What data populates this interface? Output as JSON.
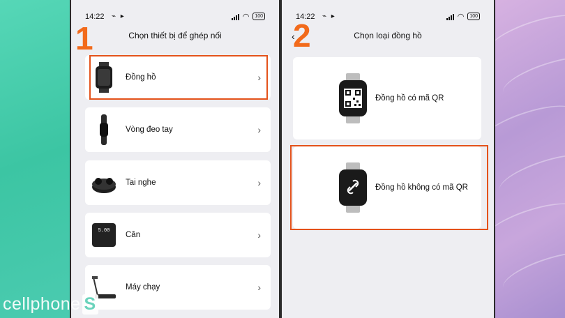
{
  "phone1": {
    "status_time": "14:22",
    "battery": "100",
    "title": "Chọn thiết bị để ghép nối",
    "items": [
      {
        "label": "Đồng hồ",
        "icon": "watch-icon",
        "highlighted": true
      },
      {
        "label": "Vòng đeo tay",
        "icon": "band-icon",
        "highlighted": false
      },
      {
        "label": "Tai nghe",
        "icon": "earbuds-icon",
        "highlighted": false
      },
      {
        "label": "Cân",
        "icon": "scale-icon",
        "highlighted": false
      },
      {
        "label": "Máy chạy",
        "icon": "treadmill-icon",
        "highlighted": false
      }
    ],
    "scale_display": "5.00"
  },
  "phone2": {
    "status_time": "14:22",
    "battery": "100",
    "title": "Chọn loại đồng hồ",
    "items": [
      {
        "label": "Đồng hồ có mã QR",
        "icon": "qr-watch-icon",
        "highlighted": false
      },
      {
        "label": "Đồng hồ không có mã QR",
        "icon": "link-watch-icon",
        "highlighted": true
      }
    ]
  },
  "steps": [
    "1",
    "2"
  ],
  "branding": {
    "logo_text": "cellphone",
    "logo_s": "S"
  },
  "colors": {
    "highlight": "#e4521b",
    "step_number": "#f26a1b",
    "screen_bg": "#eeeef2"
  }
}
